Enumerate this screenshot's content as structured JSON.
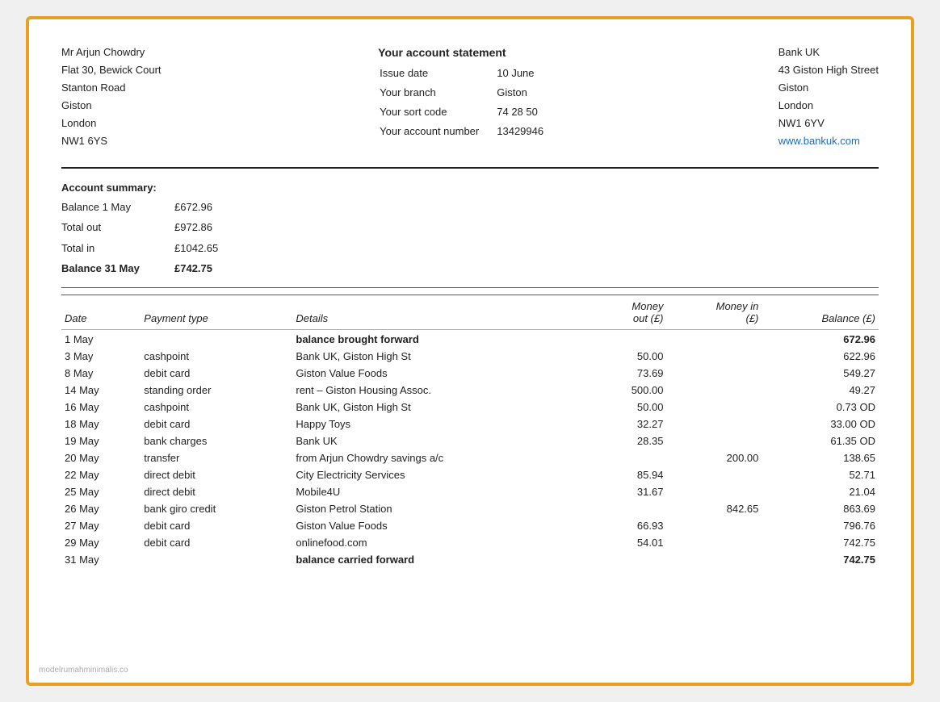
{
  "frame": {
    "border_color": "#E8A020"
  },
  "header": {
    "customer": {
      "name": "Mr Arjun Chowdry",
      "line2": "Flat 30, Bewick Court",
      "line3": "Stanton Road",
      "line4": "Giston",
      "line5": "London",
      "line6": "NW1 6YS"
    },
    "statement": {
      "title": "Your account statement",
      "issue_label": "Issue date",
      "issue_value": "10 June",
      "branch_label": "Your branch",
      "branch_value": "Giston",
      "sort_label": "Your sort code",
      "sort_value": "74 28 50",
      "account_label": "Your account number",
      "account_value": "13429946"
    },
    "bank": {
      "name": "Bank UK",
      "address1": "43 Giston High Street",
      "address2": "Giston",
      "address3": "London",
      "address4": "NW1 6YV",
      "website": "www.bankuk.com",
      "website_url": "#"
    }
  },
  "summary": {
    "title": "Account summary:",
    "rows": [
      {
        "label": "Balance 1 May",
        "value": "£672.96",
        "bold": false
      },
      {
        "label": "Total out",
        "value": "£972.86",
        "bold": false
      },
      {
        "label": "Total in",
        "value": "£1042.65",
        "bold": false
      },
      {
        "label": "Balance 31 May",
        "value": "£742.75",
        "bold": true
      }
    ]
  },
  "table": {
    "headers": [
      {
        "label": "Date",
        "subLabel": ""
      },
      {
        "label": "Payment type",
        "subLabel": ""
      },
      {
        "label": "Details",
        "subLabel": ""
      },
      {
        "label": "Money",
        "subLabel": "out (£)",
        "right": true
      },
      {
        "label": "Money in",
        "subLabel": "(£)",
        "right": true
      },
      {
        "label": "Balance (£)",
        "subLabel": "",
        "right": true
      }
    ],
    "rows": [
      {
        "date": "1 May",
        "type": "",
        "details": "balance brought forward",
        "out": "",
        "in": "",
        "balance": "672.96",
        "bold": true,
        "separator": true
      },
      {
        "date": "3 May",
        "type": "cashpoint",
        "details": "Bank UK, Giston High St",
        "out": "50.00",
        "in": "",
        "balance": "622.96",
        "bold": false,
        "separator": false
      },
      {
        "date": "8 May",
        "type": "debit card",
        "details": "Giston Value Foods",
        "out": "73.69",
        "in": "",
        "balance": "549.27",
        "bold": false,
        "separator": false
      },
      {
        "date": "14 May",
        "type": "standing order",
        "details": "rent – Giston Housing Assoc.",
        "out": "500.00",
        "in": "",
        "balance": "49.27",
        "bold": false,
        "separator": false
      },
      {
        "date": "16 May",
        "type": "cashpoint",
        "details": "Bank UK, Giston High St",
        "out": "50.00",
        "in": "",
        "balance": "0.73 OD",
        "bold": false,
        "separator": false
      },
      {
        "date": "18 May",
        "type": "debit card",
        "details": "Happy Toys",
        "out": "32.27",
        "in": "",
        "balance": "33.00 OD",
        "bold": false,
        "separator": false
      },
      {
        "date": "19 May",
        "type": "bank charges",
        "details": "Bank UK",
        "out": "28.35",
        "in": "",
        "balance": "61.35 OD",
        "bold": false,
        "separator": false
      },
      {
        "date": "20 May",
        "type": "transfer",
        "details": "from Arjun Chowdry savings a/c",
        "out": "",
        "in": "200.00",
        "balance": "138.65",
        "bold": false,
        "separator": false
      },
      {
        "date": "22 May",
        "type": "direct debit",
        "details": "City Electricity Services",
        "out": "85.94",
        "in": "",
        "balance": "52.71",
        "bold": false,
        "separator": false
      },
      {
        "date": "25 May",
        "type": "direct debit",
        "details": "Mobile4U",
        "out": "31.67",
        "in": "",
        "balance": "21.04",
        "bold": false,
        "separator": false
      },
      {
        "date": "26 May",
        "type": "bank giro credit",
        "details": "Giston Petrol Station",
        "out": "",
        "in": "842.65",
        "balance": "863.69",
        "bold": false,
        "separator": false
      },
      {
        "date": "27 May",
        "type": "debit card",
        "details": "Giston Value Foods",
        "out": "66.93",
        "in": "",
        "balance": "796.76",
        "bold": false,
        "separator": false
      },
      {
        "date": "29 May",
        "type": "debit card",
        "details": "onlinefood.com",
        "out": "54.01",
        "in": "",
        "balance": "742.75",
        "bold": false,
        "separator": false
      },
      {
        "date": "31 May",
        "type": "",
        "details": "balance carried forward",
        "out": "",
        "in": "",
        "balance": "742.75",
        "bold": true,
        "separator": false
      }
    ]
  },
  "watermark": "modelrumahminimalis.co"
}
